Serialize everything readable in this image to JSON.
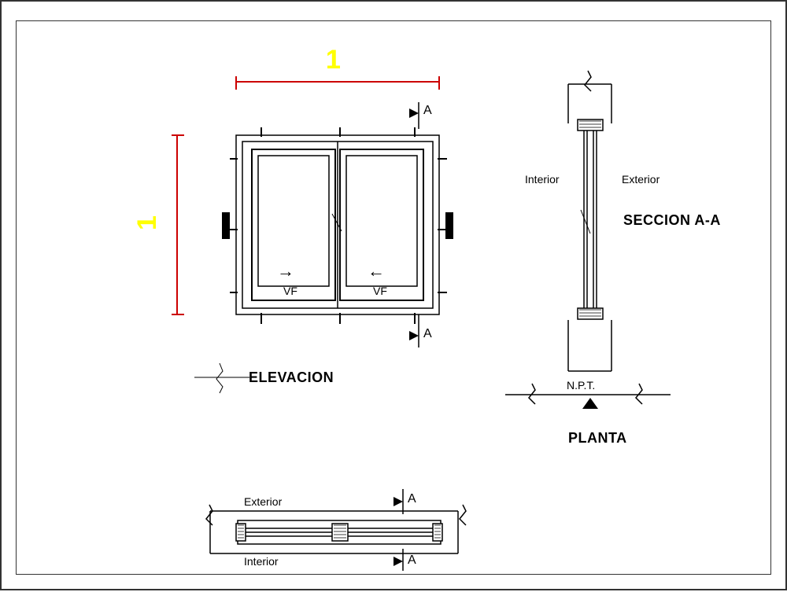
{
  "dimensions": {
    "width_label": "1",
    "height_label": "1"
  },
  "views": {
    "elevation_title": "ELEVACION",
    "section_title": "SECCION A-A",
    "plan_title": "PLANTA"
  },
  "labels": {
    "section_marker_top": "A",
    "section_marker_bottom": "A",
    "section_marker_plan_top": "A",
    "section_marker_plan_bottom": "A",
    "interior": "Interior",
    "exterior": "Exterior",
    "interior2": "Interior",
    "exterior2": "Exterior",
    "vf_left": "VF",
    "vf_right": "VF",
    "npt": "N.P.T.",
    "arrow_left": "←",
    "arrow_right": "→"
  },
  "colors": {
    "dimension": "#ffff00",
    "dim_line": "#cc0000",
    "line": "#000000"
  }
}
